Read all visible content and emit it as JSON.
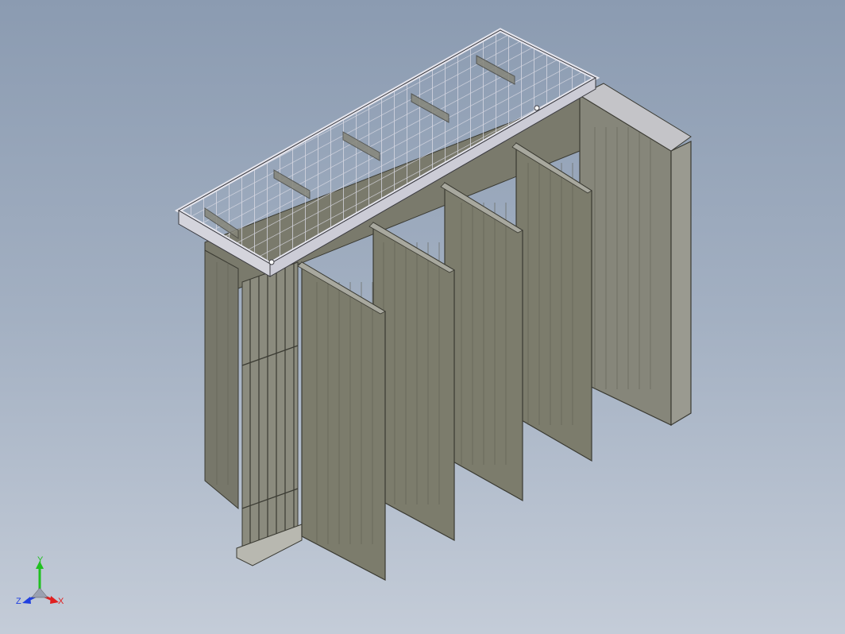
{
  "viewport": {
    "background_top": "#8b9bb1",
    "background_bottom": "#c4ccd8"
  },
  "model": {
    "panel_count": 5,
    "panel_color": "#7c7c6c",
    "panel_edge_color": "#3a3a32",
    "frame_color": "#d8d8e0",
    "mesh_color": "#c8c8d2",
    "cabinet_color": "#85857a"
  },
  "triad": {
    "x_label": "X",
    "y_label": "Y",
    "z_label": "Z",
    "x_color": "#e02020",
    "y_color": "#20c020",
    "z_color": "#2040e0"
  }
}
